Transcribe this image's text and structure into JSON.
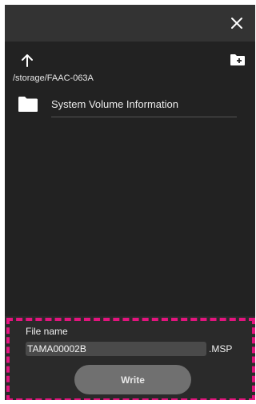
{
  "window": {
    "close_icon": "close-icon"
  },
  "toolbar": {
    "up_icon": "arrow-up-icon",
    "new_folder_icon": "new-folder-icon"
  },
  "location": {
    "path": "/storage/FAAC-063A"
  },
  "folders": [
    {
      "label": "System Volume Information",
      "icon": "folder-icon"
    }
  ],
  "save_panel": {
    "file_name_label": "File name",
    "file_name_value": "TAMA00002B",
    "extension": ".MSP",
    "write_label": "Write",
    "highlight_color": "#e3147e"
  },
  "colors": {
    "background": "#222222",
    "titlebar": "#333333",
    "button": "#707070"
  }
}
